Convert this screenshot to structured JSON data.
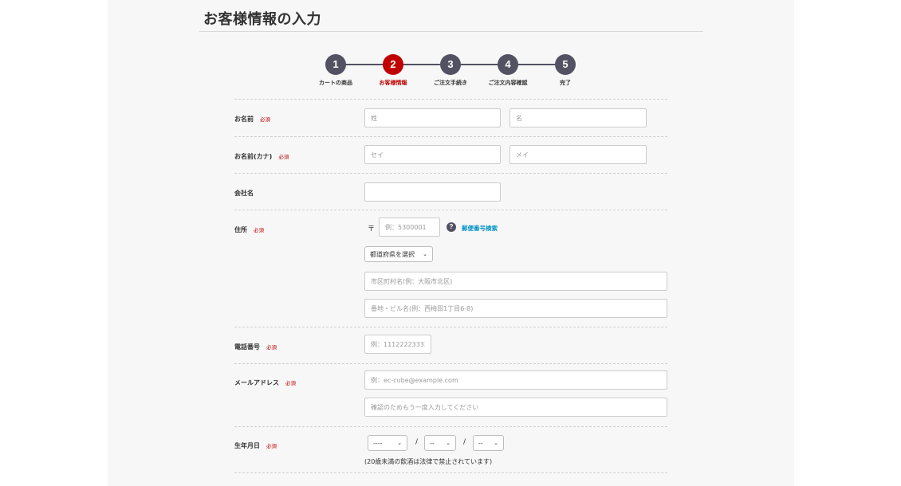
{
  "page": {
    "title": "お客様情報の入力"
  },
  "steps": [
    {
      "number": "1",
      "label": "カートの商品",
      "active": false
    },
    {
      "number": "2",
      "label": "お客様情報",
      "active": true
    },
    {
      "number": "3",
      "label": "ご注文手続き",
      "active": false
    },
    {
      "number": "4",
      "label": "ご注文内容確認",
      "active": false
    },
    {
      "number": "5",
      "label": "完了",
      "active": false
    }
  ],
  "form": {
    "required_label": "必須",
    "name": {
      "label": "お名前",
      "last_placeholder": "姓",
      "first_placeholder": "名",
      "last_value": "",
      "first_value": ""
    },
    "kana": {
      "label": "お名前(カナ)",
      "last_placeholder": "セイ",
      "first_placeholder": "メイ",
      "last_value": "",
      "first_value": ""
    },
    "company": {
      "label": "会社名",
      "value": ""
    },
    "address": {
      "label": "住所",
      "postal_mark": "〒",
      "postal_placeholder": "例：5300001",
      "help_icon": "question-circle-icon",
      "help_glyph": "?",
      "zip_search_link": "郵便番号検索",
      "prefecture_selected": "都道府県を選択",
      "city_placeholder": "市区町村名(例：大阪市北区)",
      "street_placeholder": "番地・ビル名(例：西梅田1丁目6-8)"
    },
    "phone": {
      "label": "電話番号",
      "placeholder": "例：11122223333"
    },
    "email": {
      "label": "メールアドレス",
      "placeholder": "例：ec-cube@example.com",
      "confirm_placeholder": "確認のためもう一度入力してください"
    },
    "birthday": {
      "label": "生年月日",
      "year_selected": "----",
      "month_selected": "--",
      "day_selected": "--",
      "separator": "/",
      "note": "(20歳未満の飲酒は法律で禁止されています)"
    }
  },
  "colors": {
    "accent": "#c00000",
    "step_default": "#525263",
    "link": "#0092c4"
  }
}
